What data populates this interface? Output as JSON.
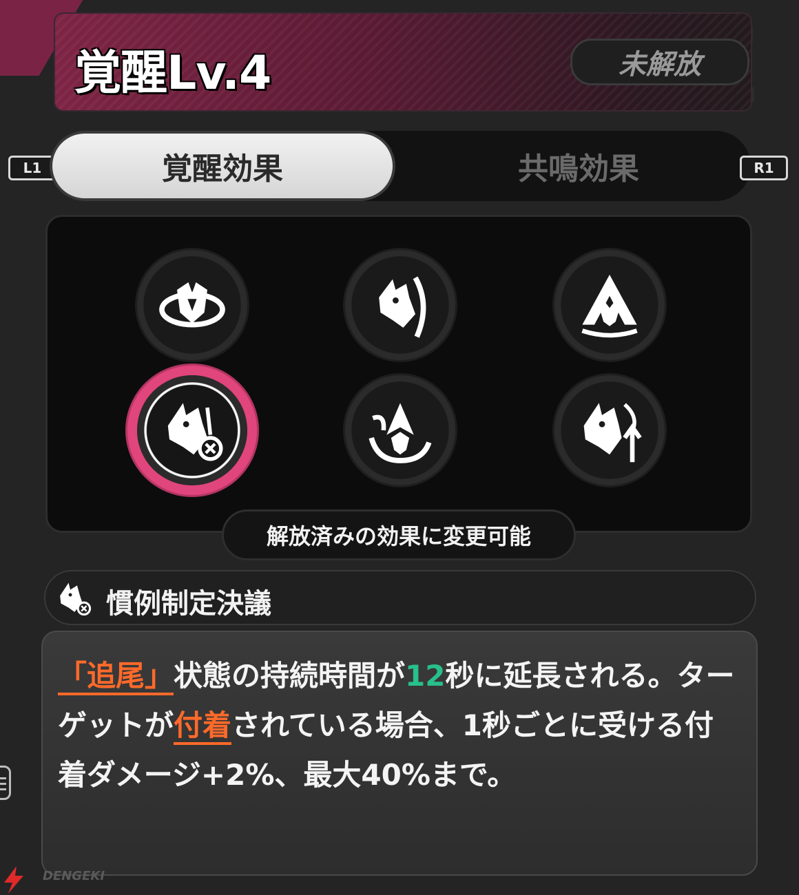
{
  "header": {
    "title": "覚醒Lv.4",
    "status": "未解放"
  },
  "tabs": [
    {
      "label": "覚醒効果",
      "active": true
    },
    {
      "label": "共鳴効果",
      "active": false
    }
  ],
  "key_hints": {
    "left": "L1",
    "right": "R1"
  },
  "skills": [
    {
      "icon": "wolf-ring-icon",
      "selected": false
    },
    {
      "icon": "wolf-slash-icon",
      "selected": false
    },
    {
      "icon": "wolf-triangle-icon",
      "selected": false
    },
    {
      "icon": "wolf-target-icon",
      "selected": true
    },
    {
      "icon": "wolf-swirl-icon",
      "selected": false
    },
    {
      "icon": "wolf-arrow-up-icon",
      "selected": false
    }
  ],
  "change_note": "解放済みの効果に変更可能",
  "selected_skill": {
    "name": "慣例制定決議",
    "icon": "wolf-target-icon"
  },
  "description": {
    "seg1": "「追尾」",
    "seg2": "状態の持続時間が",
    "seg3": "12",
    "seg4": "秒に延長される。ターゲットが",
    "seg5": "付着",
    "seg6": "されている場合、1秒ごとに受ける付着ダメージ+2%、最大40%まで。"
  },
  "colors": {
    "accent": "#e0457b",
    "keyword": "#ff6a2a",
    "value": "#28c08b"
  },
  "watermark": "DENGEKI"
}
